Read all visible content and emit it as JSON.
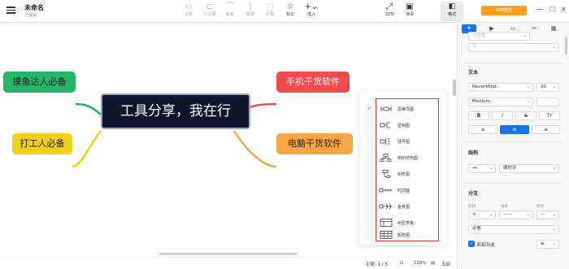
{
  "window": {
    "title": "未命名",
    "subtitle": "已编辑"
  },
  "toolbar": {
    "items": [
      {
        "label": "主题",
        "icon": "topic-icon"
      },
      {
        "label": "子主题",
        "icon": "subtopic-icon"
      },
      {
        "label": "联系",
        "icon": "relationship-icon"
      },
      {
        "label": "概要",
        "icon": "summary-icon"
      },
      {
        "label": "外框",
        "icon": "boundary-icon"
      },
      {
        "label": "标记",
        "icon": "star-marker-icon"
      },
      {
        "label": "插入",
        "icon": "plus-insert-icon"
      }
    ],
    "zen_label": "ZEN",
    "pitch_label": "演讲",
    "format_label": "格式",
    "trial_label": "试用模式"
  },
  "mindmap": {
    "central": "工具分享，我在行",
    "topics": {
      "green": "摸鱼达人必备",
      "yellow": "打工人必备",
      "red": "手机干货软件",
      "orange": "电脑干货软件"
    },
    "colors": {
      "central_bg": "#11152c",
      "green": "#27b36a",
      "yellow": "#f2cf1d",
      "red": "#f24b4b",
      "orange": "#f7a64a"
    }
  },
  "structure_menu": {
    "selected_index": 0,
    "items": [
      {
        "label": "思维导图"
      },
      {
        "label": "逻辑图"
      },
      {
        "label": "括号图"
      },
      {
        "label": "组织结构图"
      },
      {
        "label": "树形图"
      },
      {
        "label": "时间轴"
      },
      {
        "label": "鱼骨图"
      },
      {
        "label": "树型表格"
      },
      {
        "label": "矩阵图"
      }
    ]
  },
  "statusbar": {
    "topic_count": "主题: 1 / 5",
    "zoom": "120%",
    "outline": "大纲"
  },
  "panel": {
    "text_section": "文本",
    "font_family": "NeverMind",
    "font_size": "30",
    "font_weight": "Medium",
    "bold": "B",
    "italic": "I",
    "strike": "S",
    "case": "Tт",
    "structure_section": "结构",
    "direction": "顺时针",
    "branch_section": "分支",
    "shape_label": "形状",
    "line_label": "线条",
    "end_label": "终点",
    "branch_width": "中等",
    "rainbow_label": "彩虹分支",
    "top_select_1": "无边框",
    "top_select_2": "无"
  }
}
